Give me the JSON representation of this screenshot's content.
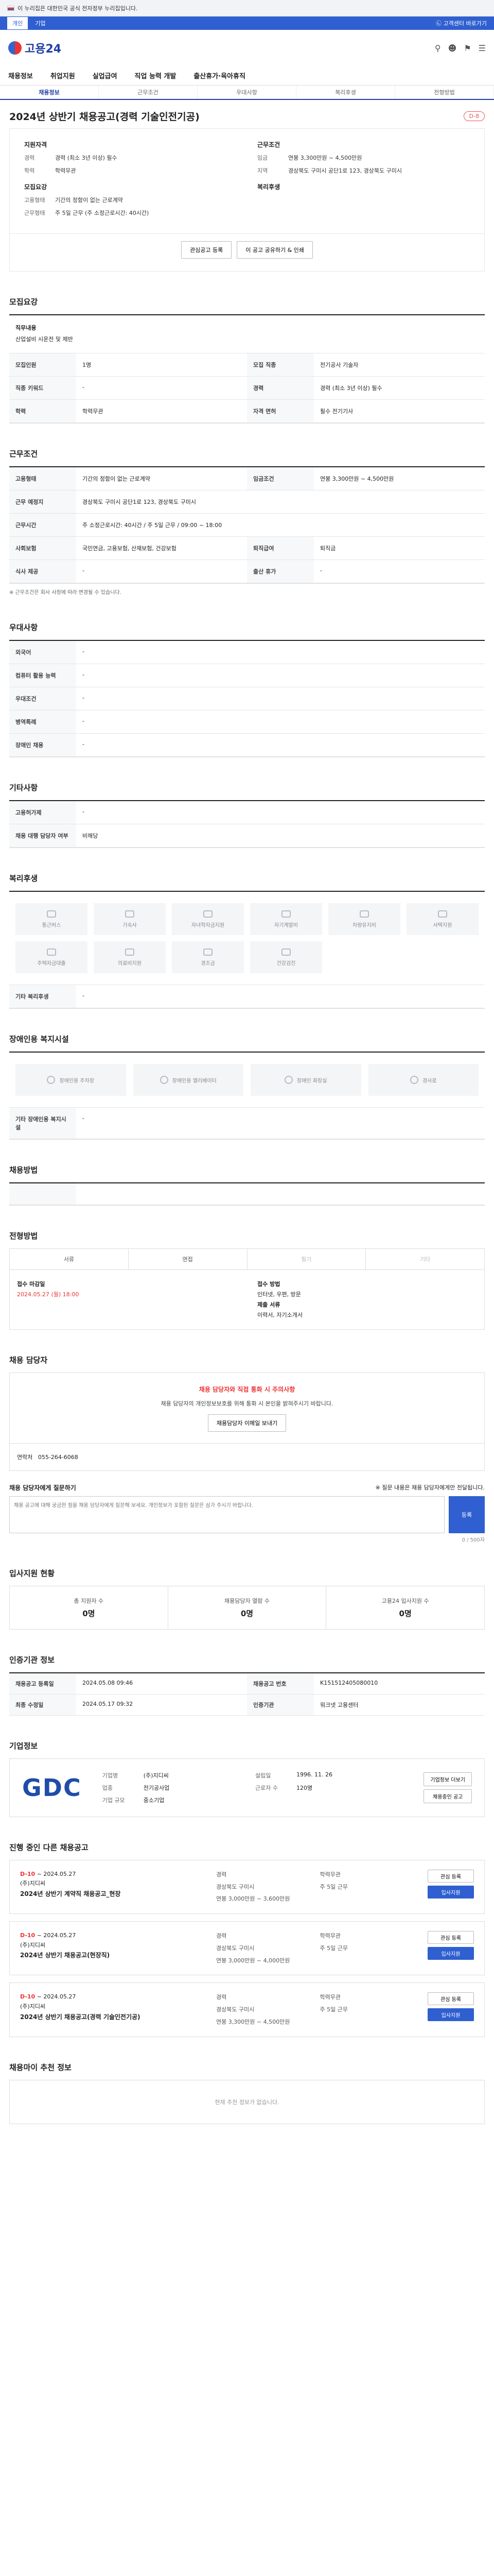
{
  "gov_banner": "이 누리집은 대한민국 공식 전자정부 누리집입니다.",
  "topbar": {
    "tabs": [
      "개인",
      "기업"
    ],
    "right_link": "㉡ 고객센터 바로가기"
  },
  "brand": {
    "logo": "고용24"
  },
  "header_icons": [
    "search-icon",
    "user-icon",
    "bell-icon",
    "menu-icon"
  ],
  "gnb": [
    "채용정보",
    "취업지원",
    "실업급여",
    "직업 능력 개발",
    "출산휴가·육아휴직"
  ],
  "tabs": [
    "채용정보",
    "근무조건",
    "우대사항",
    "복리후생",
    "전형방법"
  ],
  "job": {
    "title": "2024년 상반기 채용공고(경력 기술인전기공)",
    "status": "D-8"
  },
  "summary": {
    "qualification_title": "지원자격",
    "qual": [
      {
        "k": "경력",
        "v": "경력 (최소 3년 이상) 필수"
      },
      {
        "k": "학력",
        "v": "학력무관"
      }
    ],
    "recruit_title": "모집요강",
    "recruit": [
      {
        "k": "고용형태",
        "v": "기간의 정함이 없는 근로계약"
      },
      {
        "k": "근무형태",
        "v": "주 5일 근무 (주 소정근로시간: 40시간)"
      }
    ],
    "work_title": "근무조건",
    "work": [
      {
        "k": "임금",
        "v": "연봉 3,300만원 ~ 4,500만원"
      },
      {
        "k": "지역",
        "v": "경상북도 구미시 공단1로 123, 경상북도 구미시"
      }
    ],
    "welfare_title": "복리후생",
    "actions": {
      "interest": "관심공고 등록",
      "share": "이 공고 공유하기 & 인쇄"
    }
  },
  "section_titles": {
    "recruit": "모집요강",
    "work": "근무조건",
    "prefer": "우대사항",
    "other": "기타사항",
    "welfare": "복리후생",
    "disabled": "장애인용 복지시설",
    "process": "채용방법",
    "apply": "전형방법",
    "contact": "채용 담당자",
    "qna": "채용 담당자에게 질문하기",
    "stats": "입사지원 현황",
    "reference": "인증기관 정보",
    "company": "기업정보",
    "recent": "진행 중인 다른 채용공고",
    "review": "채용마이 추천 정보"
  },
  "duty": {
    "label": "직무내용",
    "value": "산업설비 시운전 및 제반"
  },
  "recruit_table": [
    {
      "th": "모집인원",
      "td": "1명"
    },
    {
      "th": "모집 직종",
      "td": "전기공사 기술자"
    },
    {
      "th": "직종 키워드",
      "td": "-"
    },
    {
      "th": "경력",
      "td": "경력 (최소 3년 이상) 필수"
    },
    {
      "th": "학력",
      "td": "학력무관"
    },
    {
      "th": "자격 면허",
      "td": "필수 전기기사"
    }
  ],
  "work_table": [
    {
      "th": "고용형태",
      "td": "기간의 정함이 없는 근로계약"
    },
    {
      "th": "임금조건",
      "td": "연봉 3,300만원 ~ 4,500만원"
    },
    {
      "th": "근무 예정지",
      "td": "경상북도 구미시 공단1로 123, 경상북도 구미시 "
    },
    {
      "th": "근무시간",
      "td": "주 소정근로시간: 40시간 / 주 5일 근무 / 09:00 ~ 18:00"
    },
    {
      "th": "사회보험",
      "td": "국민연금, 고용보험, 산재보험, 건강보험"
    },
    {
      "th": "퇴직급여",
      "td": "퇴직금"
    },
    {
      "th": "식사 제공",
      "td": "-"
    },
    {
      "th": "출산 휴가",
      "td": "-"
    }
  ],
  "work_note": "※ 근무조건은 회사 사정에 따라 변경될 수 있습니다.",
  "prefer_table": [
    {
      "th": "외국어",
      "td": "-"
    },
    {
      "th": "컴퓨터 활용 능력",
      "td": "-"
    },
    {
      "th": "우대조건",
      "td": "-"
    },
    {
      "th": "병역특례",
      "td": "-"
    },
    {
      "th": "장애인 채용",
      "td": "-"
    }
  ],
  "other_table": [
    {
      "th": "고용허가제",
      "td": "-"
    },
    {
      "th": "채용 대행 담당자 여부",
      "td": "비해당"
    }
  ],
  "welfare_items": [
    "통근버스",
    "기숙사",
    "자녀학자금지원",
    "자기계발비",
    "차량유지비",
    "사택지원",
    "주택자금대출",
    "의료비지원",
    "경조금",
    "건강검진"
  ],
  "welfare_other": {
    "label": "기타 복리후생",
    "value": "-"
  },
  "disabled_items": [
    "장애인용 주차장",
    "장애인용 엘리베이터",
    "장애인 화장실",
    "경사로"
  ],
  "disabled_other": {
    "label": "기타 장애인용 복지시설",
    "value": "-"
  },
  "process_steps": [
    "서류",
    "면접",
    "필기",
    "기타"
  ],
  "apply": {
    "deadline_label": "접수 마감일",
    "deadline": "2024.05.27 (월) 18:00",
    "method_label": "접수 방법",
    "method": "인터넷, 우편, 방문",
    "docs_label": "제출 서류",
    "docs": "이력서, 자기소개서"
  },
  "contact": {
    "alert_title": "채용 담당자와 직접 통화 시 주의사항",
    "alert_text": "채용 담당자의 개인정보보호를 위해 통화 시 본인을 밝혀주시기 바랍니다.",
    "phone_label": "연락처",
    "phone": "055-264-6068",
    "email_btn": "채용담당자 이메일 보내기"
  },
  "qna": {
    "placeholder": "채용 공고에 대해 궁금한 점을 채용 담당자에게 질문해 보세요. 개인정보가 포함된 질문은 삼가 주시기 바랍니다.",
    "submit": "등록",
    "count": "0 / 500자",
    "cancel_note": "※ 질문 내용은 채용 담당자에게만 전달됩니다."
  },
  "stats": [
    {
      "label": "총 지원자 수",
      "value": "0명"
    },
    {
      "label": "채용담당자 열람 수",
      "value": "0명"
    },
    {
      "label": "고용24 입사지원 수",
      "value": "0명"
    }
  ],
  "reference": [
    {
      "th": "채용공고 등록일",
      "td": "2024.05.08 09:46"
    },
    {
      "th": "최종 수정일",
      "td": "2024.05.17 09:32"
    },
    {
      "th": "채용공고 번호",
      "td": "K151512405080010"
    },
    {
      "th": "인증기관",
      "td": "워크넷 고용센터"
    }
  ],
  "company": {
    "logo": "GDC",
    "name_label": "기업명",
    "name": "(주)지디씨",
    "industry_label": "업종",
    "industry": "전기공사업",
    "size_label": "기업 규모",
    "size": "중소기업",
    "employees_label": "근로자 수",
    "employees": "120명",
    "founded_label": "설립일",
    "founded": "1996. 11. 26",
    "btn_info": "기업정보 더보기",
    "btn_jobs": "채용중인 공고"
  },
  "recent": [
    {
      "dday": "D-10",
      "date": "~ 2024.05.27",
      "company": "(주)지디씨",
      "title": "2024년 상반기 계약직 채용공고_현장",
      "career": "경력",
      "edu": "학력무관",
      "region": "경상북도 구미시",
      "type": "주 5일 근무",
      "salary": "연봉 3,000만원 ~ 3,600만원",
      "btn1": "관심 등록",
      "btn2": "입사지원"
    },
    {
      "dday": "D-10",
      "date": "~ 2024.05.27",
      "company": "(주)지디씨",
      "title": "2024년 상반기 채용공고(현장직)",
      "career": "경력",
      "edu": "학력무관",
      "region": "경상북도 구미시",
      "type": "주 5일 근무",
      "salary": "연봉 3,000만원 ~ 4,000만원",
      "btn1": "관심 등록",
      "btn2": "입사지원"
    },
    {
      "dday": "D-10",
      "date": "~ 2024.05.27",
      "company": "(주)지디씨",
      "title": "2024년 상반기 채용공고(경력 기술인전기공)",
      "career": "경력",
      "edu": "학력무관",
      "region": "경상북도 구미시",
      "type": "주 5일 근무",
      "salary": "연봉 3,300만원 ~ 4,500만원",
      "btn1": "관심 등록",
      "btn2": "입사지원"
    }
  ],
  "review_empty": "현재 추천 정보가 없습니다."
}
